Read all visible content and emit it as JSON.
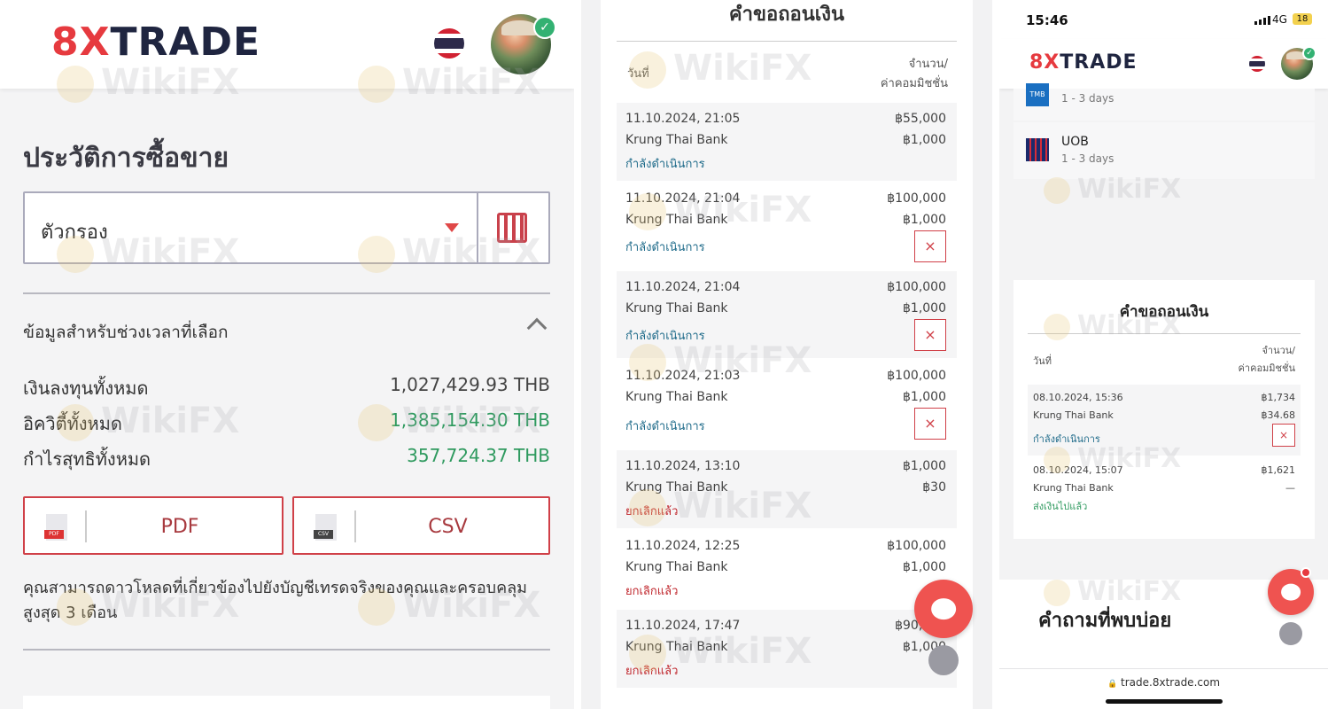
{
  "panel1": {
    "brand": {
      "part1": "8X",
      "part2": "TRADE"
    },
    "page_title": "ประวัติการซื้อขาย",
    "filter": {
      "label": "ตัวกรอง"
    },
    "section_title": "ข้อมูลสำหรับช่วงเวลาที่เลือก",
    "stats": [
      {
        "label": "เงินลงทุนทั้งหมด",
        "value": "1,027,429.93 THB"
      },
      {
        "label": "อิควิตี้ทั้งหมด",
        "value": "1,385,154.30 THB"
      },
      {
        "label": "กำไรสุทธิทั้งหมด",
        "value": "357,724.37 THB"
      }
    ],
    "buttons": {
      "pdf": "PDF",
      "csv": "CSV",
      "pdf_tag": "PDF",
      "csv_tag": "CSV"
    },
    "note": "คุณสามารถดาวโหลดที่เกี่ยวข้องไปยังบัญชีเทรดจริงของคุณและครอบคลุมสูงสุด 3 เดือน"
  },
  "panel2": {
    "title": "คำขอถอนเงิน",
    "col_date": "วันที่",
    "col_amount_line1": "จำนวน/",
    "col_amount_line2": "ค่าคอมมิชชั่น",
    "rows": [
      {
        "date": "11.10.2024, 21:05",
        "bank": "Krung Thai Bank",
        "status": "กำลังดำเนินการ",
        "amount": "฿55,000",
        "fee": "฿1,000"
      },
      {
        "date": "11.10.2024, 21:04",
        "bank": "Krung Thai Bank",
        "status": "กำลังดำเนินการ",
        "amount": "฿100,000",
        "fee": "฿1,000"
      },
      {
        "date": "11.10.2024, 21:04",
        "bank": "Krung Thai Bank",
        "status": "กำลังดำเนินการ",
        "amount": "฿100,000",
        "fee": "฿1,000"
      },
      {
        "date": "11.10.2024, 21:03",
        "bank": "Krung Thai Bank",
        "status": "กำลังดำเนินการ",
        "amount": "฿100,000",
        "fee": "฿1,000"
      },
      {
        "date": "11.10.2024, 13:10",
        "bank": "Krung Thai Bank",
        "status": "ยกเลิกแล้ว",
        "amount": "฿1,000",
        "fee": "฿30"
      },
      {
        "date": "11.10.2024, 12:25",
        "bank": "Krung Thai Bank",
        "status": "ยกเลิกแล้ว",
        "amount": "฿100,000",
        "fee": "฿1,000"
      },
      {
        "date": "11.10.2024, 17:47",
        "bank": "Krung Thai Bank",
        "status": "ยกเลิกแล้ว",
        "amount": "฿90,000",
        "fee": "฿1,000"
      }
    ],
    "cancel_glyph": "×"
  },
  "panel3": {
    "status_bar": {
      "time": "15:46",
      "network": "4G",
      "battery": "18"
    },
    "brand": {
      "part1": "8X",
      "part2": "TRADE"
    },
    "banks": [
      {
        "name": "TMB",
        "days": "1 - 3 days",
        "icon": "tmb-bank-icon"
      },
      {
        "name": "UOB",
        "days": "1 - 3 days",
        "icon": "uob-bank-icon"
      }
    ],
    "withdraw": {
      "title": "คำขอถอนเงิน",
      "col_date": "วันที่",
      "col_amount_line1": "จำนวน/",
      "col_amount_line2": "ค่าคอมมิชชั่น",
      "rows": [
        {
          "date": "08.10.2024, 15:36",
          "bank": "Krung Thai Bank",
          "status": "กำลังดำเนินการ",
          "amount": "฿1,734",
          "fee": "฿34.68"
        },
        {
          "date": "08.10.2024, 15:07",
          "bank": "Krung Thai Bank",
          "status": "ส่งเงินไปแล้ว",
          "amount": "฿1,621",
          "fee": "—"
        }
      ]
    },
    "faq_title": "คำถามที่พบบ่อย",
    "url": "trade.8xtrade.com",
    "lock": "🔒"
  },
  "watermark": "WikiFX",
  "colors": {
    "brand_red": "#e63a3f",
    "brand_navy": "#1f2540",
    "positive": "#2f9a5f",
    "pending": "#1f6b8a",
    "cancelled": "#c0272d"
  }
}
